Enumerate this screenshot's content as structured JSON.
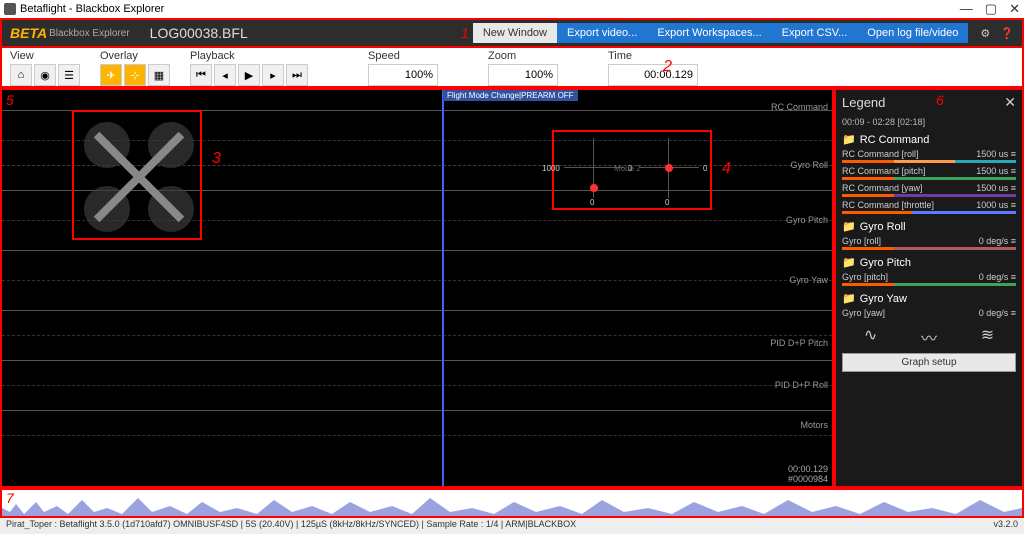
{
  "window": {
    "title": "Betaflight - Blackbox Explorer"
  },
  "header": {
    "logo": "BETA",
    "logo_sub": "Blackbox Explorer",
    "filename": "LOG00038.BFL",
    "buttons": {
      "new_window": "New Window",
      "export_video": "Export video...",
      "export_workspaces": "Export Workspaces...",
      "export_csv": "Export CSV...",
      "open_log": "Open log file/video"
    }
  },
  "annotations": {
    "a1": "1",
    "a2": "2",
    "a3": "3",
    "a4": "4",
    "a5": "5",
    "a6": "6",
    "a7": "7"
  },
  "toolbar": {
    "view_label": "View",
    "overlay_label": "Overlay",
    "playback_label": "Playback",
    "speed_label": "Speed",
    "speed_value": "100%",
    "zoom_label": "Zoom",
    "zoom_value": "100%",
    "time_label": "Time",
    "time_value": "00:00.129"
  },
  "graph": {
    "flight_mode": "Flight Mode Change|PREARM OFF",
    "labels": [
      "RC Command",
      "Gyro Roll",
      "Gyro Pitch",
      "Gyro Yaw",
      "PID D+P Pitch",
      "PID D+P Roll",
      "Motors"
    ],
    "time_readout": "00:00.129",
    "frame_readout": "#0000984",
    "sticks": {
      "mode": "Mode 2",
      "l_left": "1000",
      "l_right": "0",
      "l_bottom": "0",
      "r_left": "",
      "r_right": "0",
      "r_bottom": "0"
    }
  },
  "legend": {
    "title": "Legend",
    "timerange": "00:09 - 02:28 [02:18]",
    "sections": [
      {
        "name": "RC Command",
        "rows": [
          {
            "label": "RC Command [roll]",
            "value": "1500 us",
            "bar": [
              [
                "#ff5a00",
                30
              ],
              [
                "#ff9a4a",
                35
              ],
              [
                "#2aa6b8",
                35
              ]
            ]
          },
          {
            "label": "RC Command [pitch]",
            "value": "1500 us",
            "bar": [
              [
                "#ff5a00",
                30
              ],
              [
                "#3aa655",
                70
              ]
            ]
          },
          {
            "label": "RC Command [yaw]",
            "value": "1500 us",
            "bar": [
              [
                "#ff5a00",
                30
              ],
              [
                "#6d3aa6",
                70
              ]
            ]
          },
          {
            "label": "RC Command [throttle]",
            "value": "1000 us",
            "bar": [
              [
                "#ff5a00",
                40
              ],
              [
                "#5a7dff",
                60
              ]
            ]
          }
        ]
      },
      {
        "name": "Gyro Roll",
        "rows": [
          {
            "label": "Gyro [roll]",
            "value": "0 deg/s",
            "bar": [
              [
                "#ff5a00",
                30
              ],
              [
                "#b05a5a",
                70
              ]
            ]
          }
        ]
      },
      {
        "name": "Gyro Pitch",
        "rows": [
          {
            "label": "Gyro [pitch]",
            "value": "0 deg/s",
            "bar": [
              [
                "#ff5a00",
                30
              ],
              [
                "#3aa655",
                70
              ]
            ]
          }
        ]
      },
      {
        "name": "Gyro Yaw",
        "rows": [
          {
            "label": "Gyro [yaw]",
            "value": "0 deg/s",
            "bar": []
          }
        ]
      }
    ],
    "graph_setup": "Graph setup"
  },
  "status": {
    "left": "Pirat_Toper : Betaflight 3.5.0 (1d710afd7) OMNIBUSF4SD | 5S (20.40V) | 125µS (8kHz/8kHz/SYNCED) | Sample Rate : 1/4 | ARM|BLACKBOX",
    "right": "v3.2.0"
  }
}
